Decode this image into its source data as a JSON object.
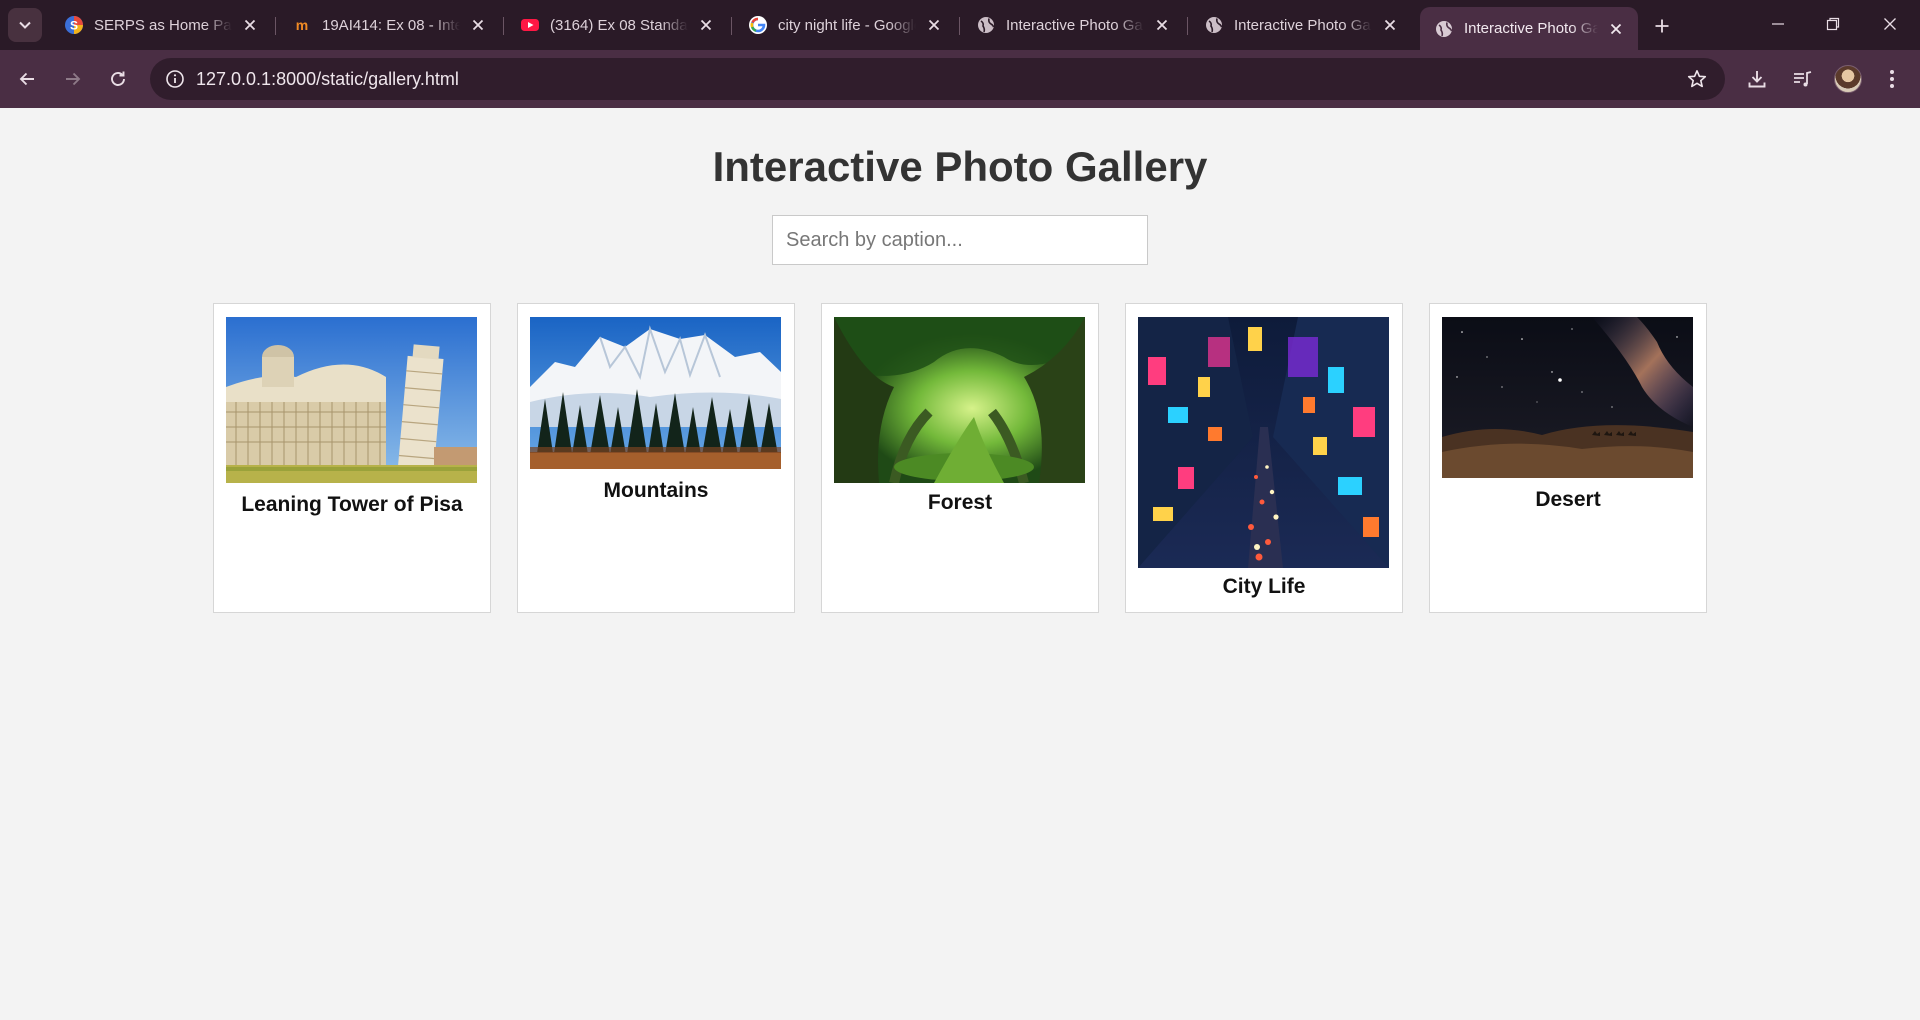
{
  "browser": {
    "tabs": [
      {
        "title": "SERPS as Home Page",
        "icon": "serps-favicon"
      },
      {
        "title": "19AI414: Ex 08 - Interactive",
        "icon": "moodle-favicon"
      },
      {
        "title": "(3164) Ex 08 Standard",
        "icon": "youtube-favicon"
      },
      {
        "title": "city night life - Google",
        "icon": "google-favicon"
      },
      {
        "title": "Interactive Photo Gallery",
        "icon": "globe-favicon"
      },
      {
        "title": "Interactive Photo Gallery",
        "icon": "globe-favicon"
      },
      {
        "title": "Interactive Photo Gallery",
        "icon": "globe-favicon",
        "active": true
      }
    ],
    "url": "127.0.0.1:8000/static/gallery.html",
    "colors": {
      "frame": "#2a1a27",
      "toolbar": "#4a2e44",
      "omnibox": "#301d2c"
    }
  },
  "page": {
    "title": "Interactive Photo Gallery",
    "search_placeholder": "Search by caption...",
    "photos": [
      {
        "caption": "Leaning Tower of Pisa",
        "scene": "pisa"
      },
      {
        "caption": "Mountains",
        "scene": "mountains"
      },
      {
        "caption": "Forest",
        "scene": "forest"
      },
      {
        "caption": "City Life",
        "scene": "city"
      },
      {
        "caption": "Desert",
        "scene": "desert"
      }
    ]
  }
}
